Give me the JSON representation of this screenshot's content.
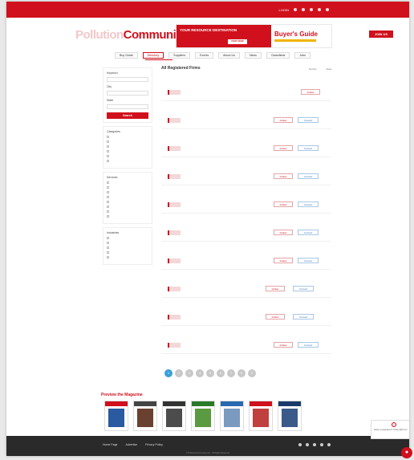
{
  "brand": {
    "logo_part1": "Pollution",
    "logo_part2": "Community.com",
    "accent_color": "#d0101c"
  },
  "topbar": {
    "login_label": "LOGIN",
    "icons": [
      "facebook-icon",
      "twitter-icon",
      "linkedin-icon",
      "youtube-icon",
      "email-icon"
    ]
  },
  "ad": {
    "left_text": "YOUR RESOURCE DESTINATION",
    "left_button": "VISIT NOW",
    "right_title": "Buyer's Guide"
  },
  "header": {
    "join_label": "JOIN US"
  },
  "nav": {
    "items": [
      "Buy Guide",
      "Directory",
      "Suppliers",
      "Events",
      "About Us",
      "News",
      "Classifieds",
      "Jobs"
    ]
  },
  "sidebar": {
    "keyword_label": "Keyword",
    "keyword_placeholder": "",
    "city_label": "City",
    "city_value": "",
    "state_label": "State",
    "state_value": "",
    "search_label": "Search",
    "group1_title": "Categories",
    "group1_items": [
      "",
      "",
      "",
      "",
      "",
      ""
    ],
    "group2_title": "Services",
    "group2_items": [
      "",
      "",
      "",
      "",
      "",
      "",
      "",
      ""
    ],
    "group3_title": "Industries",
    "group3_items": [
      "",
      "",
      "",
      "",
      ""
    ]
  },
  "content": {
    "heading": "All Registered Firms",
    "subheading": "",
    "sort_a": "Sort by",
    "sort_b": "View"
  },
  "listings": [
    {
      "name": "",
      "b1": "Follow",
      "b2": ""
    },
    {
      "name": "",
      "b1": "Follow",
      "b2": "Contact"
    },
    {
      "name": "",
      "b1": "Follow",
      "b2": "Contact"
    },
    {
      "name": "",
      "b1": "Follow",
      "b2": "Contact"
    },
    {
      "name": "",
      "b1": "Follow",
      "b2": "Contact"
    },
    {
      "name": "",
      "b1": "Follow",
      "b2": "Contact"
    },
    {
      "name": "",
      "b1": "Follow",
      "b2": "Contact"
    },
    {
      "name": "",
      "b1": "Follow",
      "b2": "Contact"
    },
    {
      "name": "",
      "b1": "Follow",
      "b2": "Contact"
    },
    {
      "name": "",
      "b1": "Follow",
      "b2": "Contact"
    }
  ],
  "pager": {
    "pages": [
      "1",
      "2",
      "3",
      "4",
      "5",
      "6",
      "7",
      "8",
      "9"
    ],
    "current": "1"
  },
  "magazines": {
    "title": "Preview the Magazine",
    "covers": [
      {
        "top": "#d0101c",
        "body": "#2a5aa0"
      },
      {
        "top": "#444",
        "body": "#6a4030"
      },
      {
        "top": "#333",
        "body": "#4c4c4c"
      },
      {
        "top": "#2a7a2a",
        "body": "#5a9a40"
      },
      {
        "top": "#2a6ab0",
        "body": "#7a9ac0"
      },
      {
        "top": "#d0101c",
        "body": "#c04040"
      },
      {
        "top": "#1a3a6a",
        "body": "#3a5a8a"
      }
    ]
  },
  "footer": {
    "links": [
      "Home Page",
      "Advertise",
      "Privacy Policy"
    ],
    "copyright": "© PollutionCommunity.com - All Rights Reserved"
  },
  "chat": {
    "text": "Have a question? Chat with us!"
  }
}
